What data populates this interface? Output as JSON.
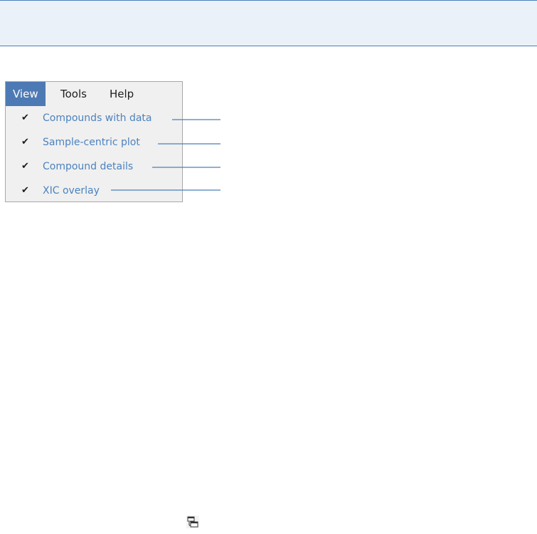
{
  "menubar": {
    "items": [
      {
        "label": "View",
        "active": true
      },
      {
        "label": "Tools",
        "active": false
      },
      {
        "label": "Help",
        "active": false
      }
    ]
  },
  "view_menu": {
    "items": [
      {
        "label": "Compounds with data",
        "checked": true
      },
      {
        "label": "Sample-centric plot",
        "checked": true
      },
      {
        "label": "Compound details",
        "checked": true
      },
      {
        "label": "XIC overlay",
        "checked": true
      }
    ]
  },
  "check_glyph": "✔",
  "bottom_icon": "window-arrange-icon",
  "colors": {
    "accent": "#4d7ab4",
    "label_text": "#4c82be",
    "callout_line": "#4a7fb8",
    "band": "#eaf1f9"
  }
}
